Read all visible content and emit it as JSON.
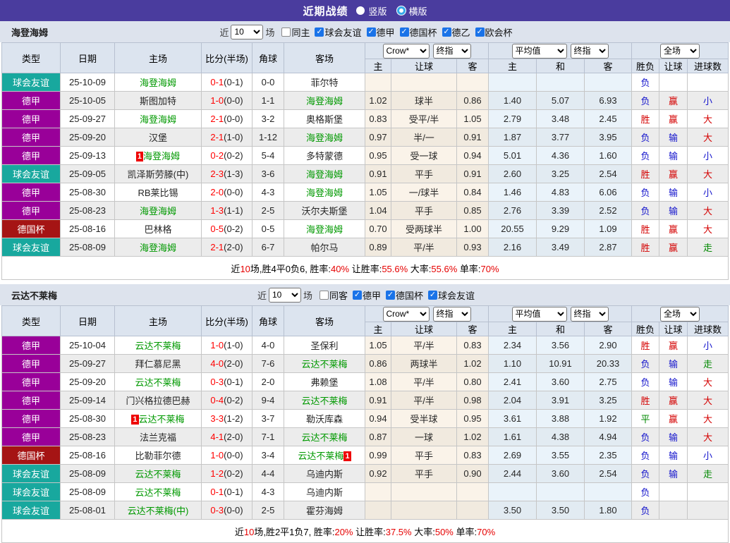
{
  "title_bar": {
    "title": "近期战绩",
    "view_options": [
      {
        "label": "竖版",
        "selected": true
      },
      {
        "label": "横版",
        "selected": false
      }
    ]
  },
  "filter_labels": {
    "near": "近",
    "games": "场",
    "count": "10"
  },
  "columns": {
    "left": [
      "类型",
      "日期",
      "主场",
      "比分(半场)",
      "角球",
      "客场"
    ],
    "groups": [
      {
        "selects": [
          "Crow*",
          "终指"
        ],
        "cols": [
          "主",
          "让球",
          "客"
        ]
      },
      {
        "selects": [
          "平均值",
          "终指"
        ],
        "cols": [
          "主",
          "和",
          "客"
        ]
      },
      {
        "selects": [
          "全场"
        ],
        "cols": [
          "胜负",
          "让球",
          "进球数"
        ]
      }
    ]
  },
  "colors": {
    "accent_bar": "#4a3c9e",
    "team_green": "#009900",
    "score_red": "#ff0000",
    "type_badges": {
      "球会友谊": "#18a89e",
      "德甲": "#990099",
      "德国杯": "#a51414"
    },
    "result_text": {
      "red": "#d40000",
      "blue": "#1414cc",
      "green": "#008800"
    }
  },
  "sections": [
    {
      "team": "海登海姆",
      "same_label": "同主",
      "same_checked": false,
      "leagues": [
        {
          "label": "球会友谊",
          "checked": true
        },
        {
          "label": "德甲",
          "checked": true
        },
        {
          "label": "德国杯",
          "checked": true
        },
        {
          "label": "德乙",
          "checked": true
        },
        {
          "label": "欧会杯",
          "checked": true
        }
      ],
      "rows": [
        {
          "type": "球会友谊",
          "date": "25-10-09",
          "home": "海登海姆",
          "green": "home",
          "score": "0-1",
          "half": "(0-1)",
          "corner": "0-0",
          "away": "菲尔特",
          "odds": [
            "",
            "",
            ""
          ],
          "avg": [
            "",
            "",
            ""
          ],
          "result": [
            "负",
            "",
            ""
          ]
        },
        {
          "type": "德甲",
          "date": "25-10-05",
          "home": "斯图加特",
          "green": "away",
          "score": "1-0",
          "half": "(0-0)",
          "corner": "1-1",
          "away": "海登海姆",
          "odds": [
            "1.02",
            "球半",
            "0.86"
          ],
          "avg": [
            "1.40",
            "5.07",
            "6.93"
          ],
          "result": [
            "负",
            "赢",
            "小"
          ]
        },
        {
          "type": "德甲",
          "date": "25-09-27",
          "home": "海登海姆",
          "green": "home",
          "score": "2-1",
          "half": "(0-0)",
          "corner": "3-2",
          "away": "奥格斯堡",
          "odds": [
            "0.83",
            "受平/半",
            "1.05"
          ],
          "avg": [
            "2.79",
            "3.48",
            "2.45"
          ],
          "result": [
            "胜",
            "赢",
            "大"
          ]
        },
        {
          "type": "德甲",
          "date": "25-09-20",
          "home": "汉堡",
          "green": "away",
          "score": "2-1",
          "half": "(1-0)",
          "corner": "1-12",
          "away": "海登海姆",
          "odds": [
            "0.97",
            "半/一",
            "0.91"
          ],
          "avg": [
            "1.87",
            "3.77",
            "3.95"
          ],
          "result": [
            "负",
            "输",
            "大"
          ]
        },
        {
          "type": "德甲",
          "date": "25-09-13",
          "home": "海登海姆",
          "home_card": "1",
          "green": "home",
          "score": "0-2",
          "half": "(0-2)",
          "corner": "5-4",
          "away": "多特蒙德",
          "odds": [
            "0.95",
            "受一球",
            "0.94"
          ],
          "avg": [
            "5.01",
            "4.36",
            "1.60"
          ],
          "result": [
            "负",
            "输",
            "小"
          ]
        },
        {
          "type": "球会友谊",
          "date": "25-09-05",
          "home": "凯泽斯劳滕(中)",
          "green": "away",
          "score": "2-3",
          "half": "(1-3)",
          "corner": "3-6",
          "away": "海登海姆",
          "odds": [
            "0.91",
            "平手",
            "0.91"
          ],
          "avg": [
            "2.60",
            "3.25",
            "2.54"
          ],
          "result": [
            "胜",
            "赢",
            "大"
          ]
        },
        {
          "type": "德甲",
          "date": "25-08-30",
          "home": "RB莱比锡",
          "green": "away",
          "score": "2-0",
          "half": "(0-0)",
          "corner": "4-3",
          "away": "海登海姆",
          "odds": [
            "1.05",
            "一/球半",
            "0.84"
          ],
          "avg": [
            "1.46",
            "4.83",
            "6.06"
          ],
          "result": [
            "负",
            "输",
            "小"
          ]
        },
        {
          "type": "德甲",
          "date": "25-08-23",
          "home": "海登海姆",
          "green": "home",
          "score": "1-3",
          "half": "(1-1)",
          "corner": "2-5",
          "away": "沃尔夫斯堡",
          "odds": [
            "1.04",
            "平手",
            "0.85"
          ],
          "avg": [
            "2.76",
            "3.39",
            "2.52"
          ],
          "result": [
            "负",
            "输",
            "大"
          ]
        },
        {
          "type": "德国杯",
          "date": "25-08-16",
          "home": "巴林格",
          "green": "away",
          "score": "0-5",
          "half": "(0-2)",
          "corner": "0-5",
          "away": "海登海姆",
          "odds": [
            "0.70",
            "受两球半",
            "1.00"
          ],
          "avg": [
            "20.55",
            "9.29",
            "1.09"
          ],
          "result": [
            "胜",
            "赢",
            "大"
          ]
        },
        {
          "type": "球会友谊",
          "date": "25-08-09",
          "home": "海登海姆",
          "green": "home",
          "score": "2-1",
          "half": "(2-0)",
          "corner": "6-7",
          "away": "帕尔马",
          "odds": [
            "0.89",
            "平/半",
            "0.93"
          ],
          "avg": [
            "2.16",
            "3.49",
            "2.87"
          ],
          "result": [
            "胜",
            "赢",
            "走"
          ]
        }
      ],
      "summary": [
        {
          "t": "近"
        },
        {
          "t": "10",
          "red": true
        },
        {
          "t": "场,胜4平0负6, 胜率:"
        },
        {
          "t": "40%",
          "red": true
        },
        {
          "t": " 让胜率:"
        },
        {
          "t": "55.6%",
          "red": true
        },
        {
          "t": " 大率:"
        },
        {
          "t": "55.6%",
          "red": true
        },
        {
          "t": " 单率:"
        },
        {
          "t": "70%",
          "red": true
        }
      ]
    },
    {
      "team": "云达不莱梅",
      "same_label": "同客",
      "same_checked": false,
      "leagues": [
        {
          "label": "德甲",
          "checked": true
        },
        {
          "label": "德国杯",
          "checked": true
        },
        {
          "label": "球会友谊",
          "checked": true
        }
      ],
      "rows": [
        {
          "type": "德甲",
          "date": "25-10-04",
          "home": "云达不莱梅",
          "green": "home",
          "score": "1-0",
          "half": "(1-0)",
          "corner": "4-0",
          "away": "圣保利",
          "odds": [
            "1.05",
            "平/半",
            "0.83"
          ],
          "avg": [
            "2.34",
            "3.56",
            "2.90"
          ],
          "result": [
            "胜",
            "赢",
            "小"
          ]
        },
        {
          "type": "德甲",
          "date": "25-09-27",
          "home": "拜仁慕尼黑",
          "green": "away",
          "score": "4-0",
          "half": "(2-0)",
          "corner": "7-6",
          "away": "云达不莱梅",
          "odds": [
            "0.86",
            "两球半",
            "1.02"
          ],
          "avg": [
            "1.10",
            "10.91",
            "20.33"
          ],
          "result": [
            "负",
            "输",
            "走"
          ]
        },
        {
          "type": "德甲",
          "date": "25-09-20",
          "home": "云达不莱梅",
          "green": "home",
          "score": "0-3",
          "half": "(0-1)",
          "corner": "2-0",
          "away": "弗赖堡",
          "odds": [
            "1.08",
            "平/半",
            "0.80"
          ],
          "avg": [
            "2.41",
            "3.60",
            "2.75"
          ],
          "result": [
            "负",
            "输",
            "大"
          ]
        },
        {
          "type": "德甲",
          "date": "25-09-14",
          "home": "门兴格拉德巴赫",
          "green": "away",
          "score": "0-4",
          "half": "(0-2)",
          "corner": "9-4",
          "away": "云达不莱梅",
          "odds": [
            "0.91",
            "平/半",
            "0.98"
          ],
          "avg": [
            "2.04",
            "3.91",
            "3.25"
          ],
          "result": [
            "胜",
            "赢",
            "大"
          ]
        },
        {
          "type": "德甲",
          "date": "25-08-30",
          "home": "云达不莱梅",
          "home_card": "1",
          "green": "home",
          "score": "3-3",
          "half": "(1-2)",
          "corner": "3-7",
          "away": "勒沃库森",
          "odds": [
            "0.94",
            "受半球",
            "0.95"
          ],
          "avg": [
            "3.61",
            "3.88",
            "1.92"
          ],
          "result": [
            "平",
            "赢",
            "大"
          ]
        },
        {
          "type": "德甲",
          "date": "25-08-23",
          "home": "法兰克福",
          "green": "away",
          "score": "4-1",
          "half": "(2-0)",
          "corner": "7-1",
          "away": "云达不莱梅",
          "odds": [
            "0.87",
            "一球",
            "1.02"
          ],
          "avg": [
            "1.61",
            "4.38",
            "4.94"
          ],
          "result": [
            "负",
            "输",
            "大"
          ]
        },
        {
          "type": "德国杯",
          "date": "25-08-16",
          "home": "比勒菲尔德",
          "green": "away",
          "away_card": "1",
          "score": "1-0",
          "half": "(0-0)",
          "corner": "3-4",
          "away": "云达不莱梅",
          "odds": [
            "0.99",
            "平手",
            "0.83"
          ],
          "avg": [
            "2.69",
            "3.55",
            "2.35"
          ],
          "result": [
            "负",
            "输",
            "小"
          ]
        },
        {
          "type": "球会友谊",
          "date": "25-08-09",
          "home": "云达不莱梅",
          "green": "home",
          "score": "1-2",
          "half": "(0-2)",
          "corner": "4-4",
          "away": "乌迪内斯",
          "odds": [
            "0.92",
            "平手",
            "0.90"
          ],
          "avg": [
            "2.44",
            "3.60",
            "2.54"
          ],
          "result": [
            "负",
            "输",
            "走"
          ]
        },
        {
          "type": "球会友谊",
          "date": "25-08-09",
          "home": "云达不莱梅",
          "green": "home",
          "score": "0-1",
          "half": "(0-1)",
          "corner": "4-3",
          "away": "乌迪内斯",
          "odds": [
            "",
            "",
            ""
          ],
          "avg": [
            "",
            "",
            ""
          ],
          "result": [
            "负",
            "",
            ""
          ]
        },
        {
          "type": "球会友谊",
          "date": "25-08-01",
          "home": "云达不莱梅(中)",
          "green": "home",
          "score": "0-3",
          "half": "(0-0)",
          "corner": "2-5",
          "away": "霍芬海姆",
          "odds": [
            "",
            "",
            ""
          ],
          "avg": [
            "3.50",
            "3.50",
            "1.80"
          ],
          "result": [
            "负",
            "",
            ""
          ]
        }
      ],
      "summary": [
        {
          "t": "近"
        },
        {
          "t": "10",
          "red": true
        },
        {
          "t": "场,胜2平1负7, 胜率:"
        },
        {
          "t": "20%",
          "red": true
        },
        {
          "t": " 让胜率:"
        },
        {
          "t": "37.5%",
          "red": true
        },
        {
          "t": " 大率:"
        },
        {
          "t": "50%",
          "red": true
        },
        {
          "t": " 单率:"
        },
        {
          "t": "70%",
          "red": true
        }
      ]
    }
  ]
}
